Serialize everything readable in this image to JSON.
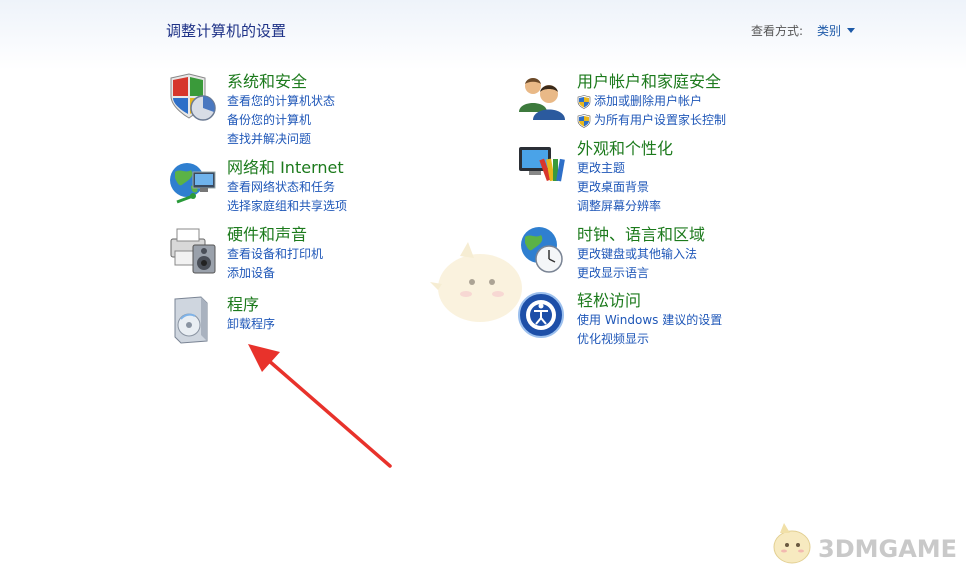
{
  "header": {
    "title": "调整计算机的设置",
    "view_by_label": "查看方式:",
    "view_by_value": "类别"
  },
  "categories": [
    {
      "title": "系统和安全",
      "icon": "shield-chart-icon",
      "links": [
        "查看您的计算机状态",
        "备份您的计算机",
        "查找并解决问题"
      ]
    },
    {
      "title": "网络和 Internet",
      "icon": "globe-network-icon",
      "links": [
        "查看网络状态和任务",
        "选择家庭组和共享选项"
      ]
    },
    {
      "title": "硬件和声音",
      "icon": "printer-speaker-icon",
      "links": [
        "查看设备和打印机",
        "添加设备"
      ]
    },
    {
      "title": "程序",
      "icon": "program-disc-icon",
      "links": [
        "卸载程序"
      ]
    },
    {
      "title": "用户帐户和家庭安全",
      "icon": "users-icon",
      "links": [
        "添加或删除用户帐户",
        "为所有用户设置家长控制"
      ]
    },
    {
      "title": "外观和个性化",
      "icon": "monitor-paint-icon",
      "links": [
        "更改主题",
        "更改桌面背景",
        "调整屏幕分辨率"
      ]
    },
    {
      "title": "时钟、语言和区域",
      "icon": "clock-globe-icon",
      "links": [
        "更改键盘或其他输入法",
        "更改显示语言"
      ]
    },
    {
      "title": "轻松访问",
      "icon": "accessibility-icon",
      "links": [
        "使用 Windows 建议的设置",
        "优化视频显示"
      ]
    }
  ],
  "watermark": {
    "text": "3DMGAME"
  },
  "colors": {
    "category_title": "#1c7a1c",
    "link": "#1f57b8",
    "header_title": "#1e3287",
    "arrow": "#e8322b"
  }
}
